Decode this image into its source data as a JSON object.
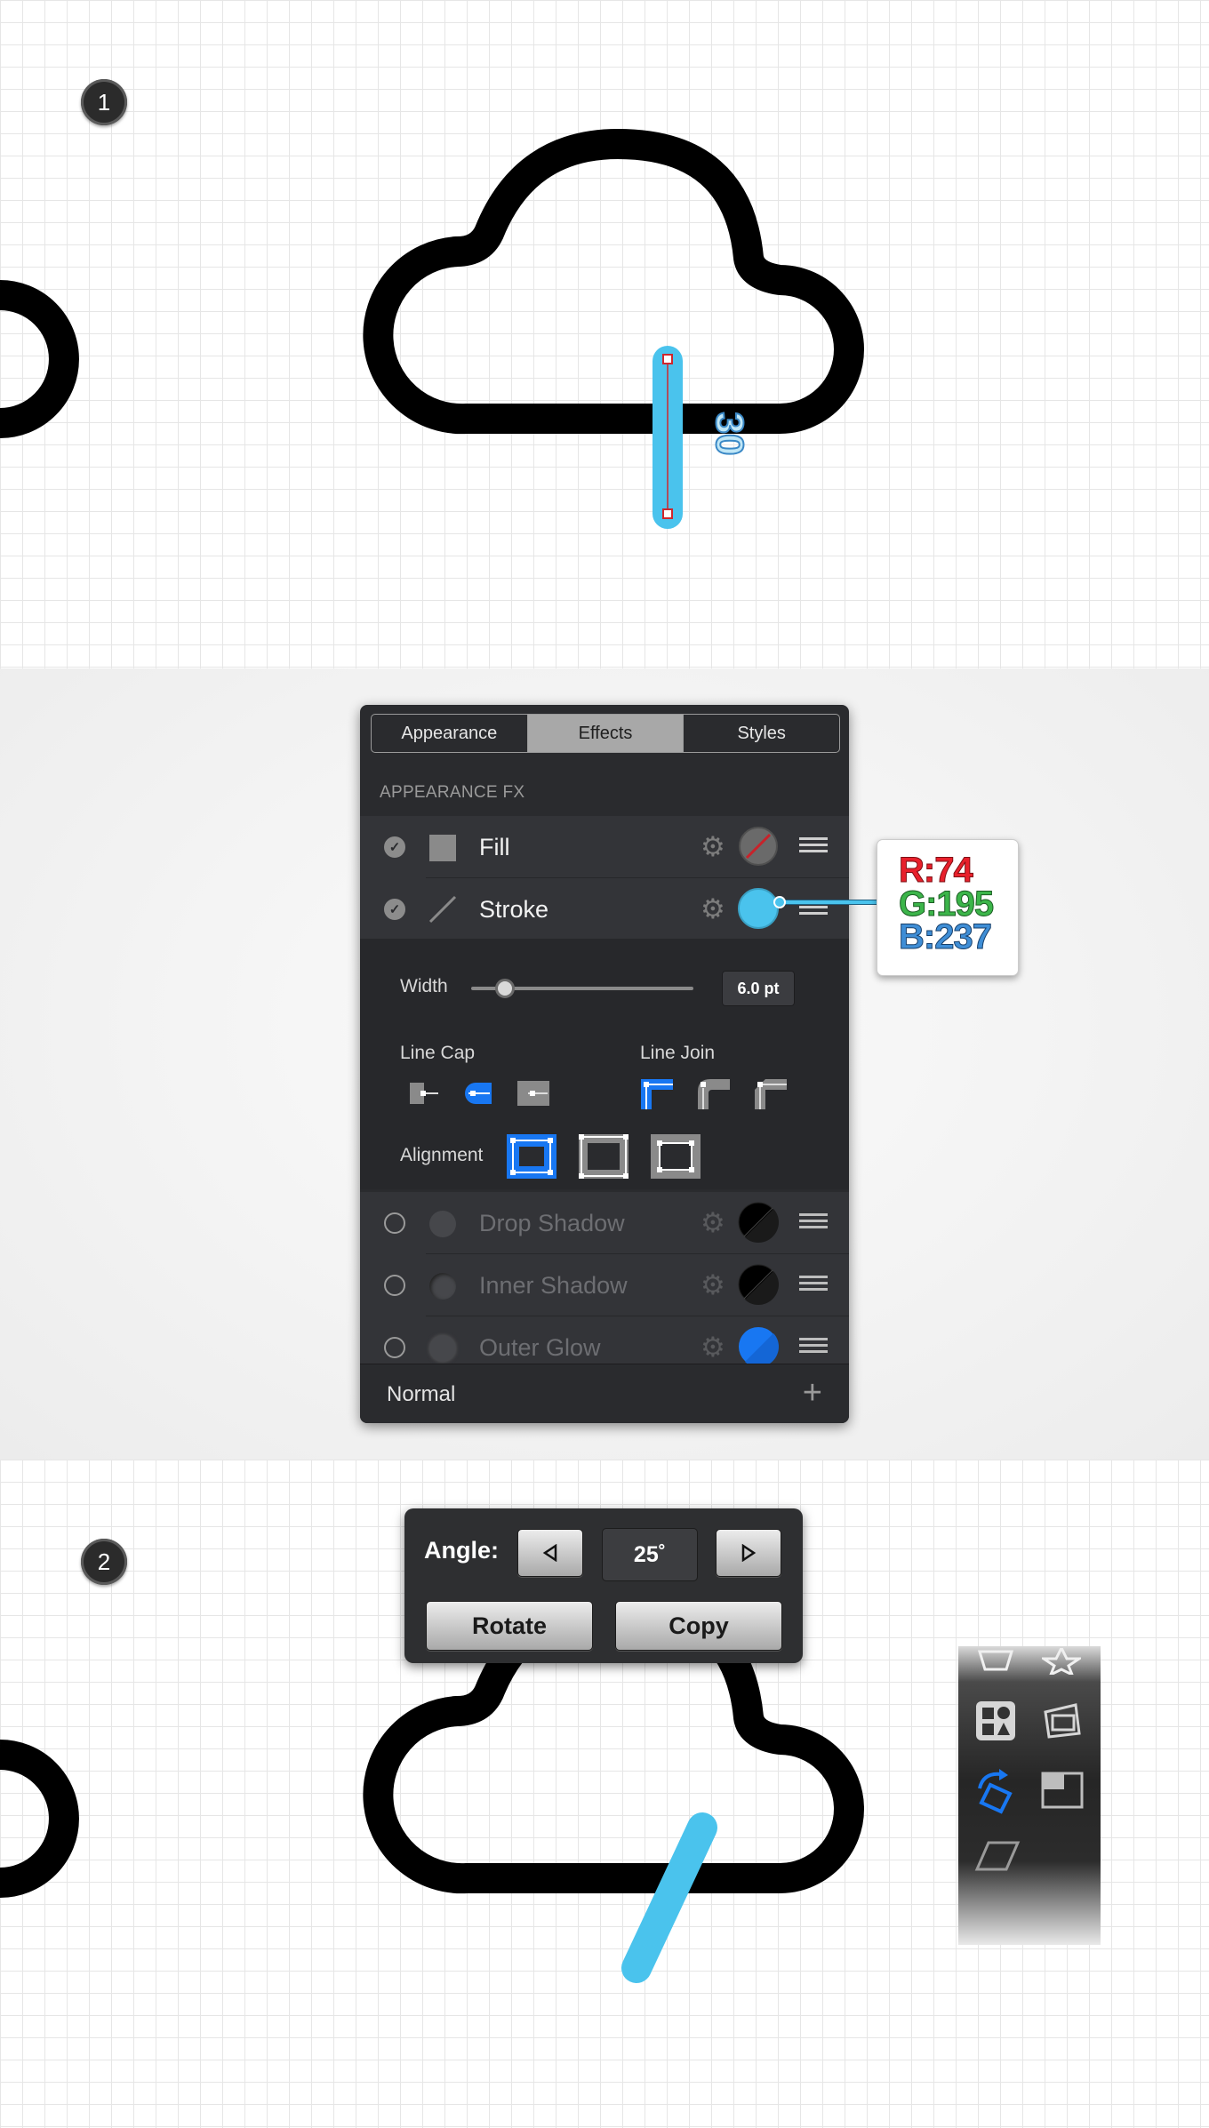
{
  "steps": {
    "one": "1",
    "two": "2"
  },
  "canvas1": {
    "angle_readout": "30",
    "stroke_color": "#4ac3ed"
  },
  "panel": {
    "tabs": [
      "Appearance",
      "Effects",
      "Styles"
    ],
    "active_tab": "Effects",
    "section_title": "APPEARANCE FX",
    "fill": {
      "label": "Fill",
      "checked": true
    },
    "stroke": {
      "label": "Stroke",
      "checked": true,
      "color": "#4ac3ed"
    },
    "width_label": "Width",
    "width_value": "6.0 pt",
    "width_slider_fraction": 0.15,
    "line_cap_label": "Line Cap",
    "line_join_label": "Line Join",
    "alignment_label": "Alignment",
    "effects": [
      {
        "label": "Drop Shadow",
        "checked": false
      },
      {
        "label": "Inner Shadow",
        "checked": false
      },
      {
        "label": "Outer Glow",
        "checked": false,
        "color": "#1877f2"
      }
    ],
    "blend_mode": "Normal"
  },
  "rgb": {
    "r": "R:74",
    "g": "G:195",
    "b": "B:237"
  },
  "rotate_dialog": {
    "angle_label": "Angle:",
    "angle_value": "25˚",
    "rotate_label": "Rotate",
    "copy_label": "Copy"
  },
  "colors": {
    "accent_blue": "#1877f2",
    "stroke_blue": "#4ac3ed",
    "handle_red": "#d0262c"
  }
}
